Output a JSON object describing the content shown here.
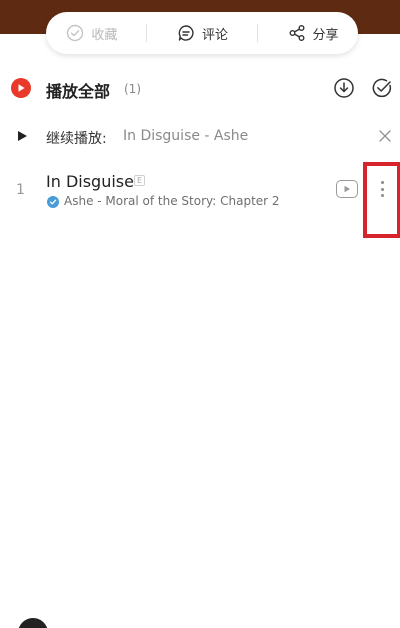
{
  "colors": {
    "header_brown": "#5e2a12",
    "accent_red": "#e8392b",
    "highlight_red": "#d7232b",
    "verified_blue": "#4a9bd8"
  },
  "action_bar": {
    "collect": {
      "label": "收藏",
      "icon": "collect-check-icon",
      "enabled": false
    },
    "comment": {
      "label": "评论",
      "icon": "comment-icon"
    },
    "share": {
      "label": "分享",
      "icon": "share-icon"
    }
  },
  "playlist_header": {
    "play_all_label": "播放全部",
    "count": "(1)",
    "icons": [
      "download-icon",
      "multi-select-icon"
    ]
  },
  "continue_play": {
    "label": "继续播放:",
    "track": "In Disguise - Ashe"
  },
  "songs": [
    {
      "index": "1",
      "title": "In Disguise",
      "explicit": "E",
      "subtitle": "Ashe - Moral of the Story: Chapter 2"
    }
  ]
}
